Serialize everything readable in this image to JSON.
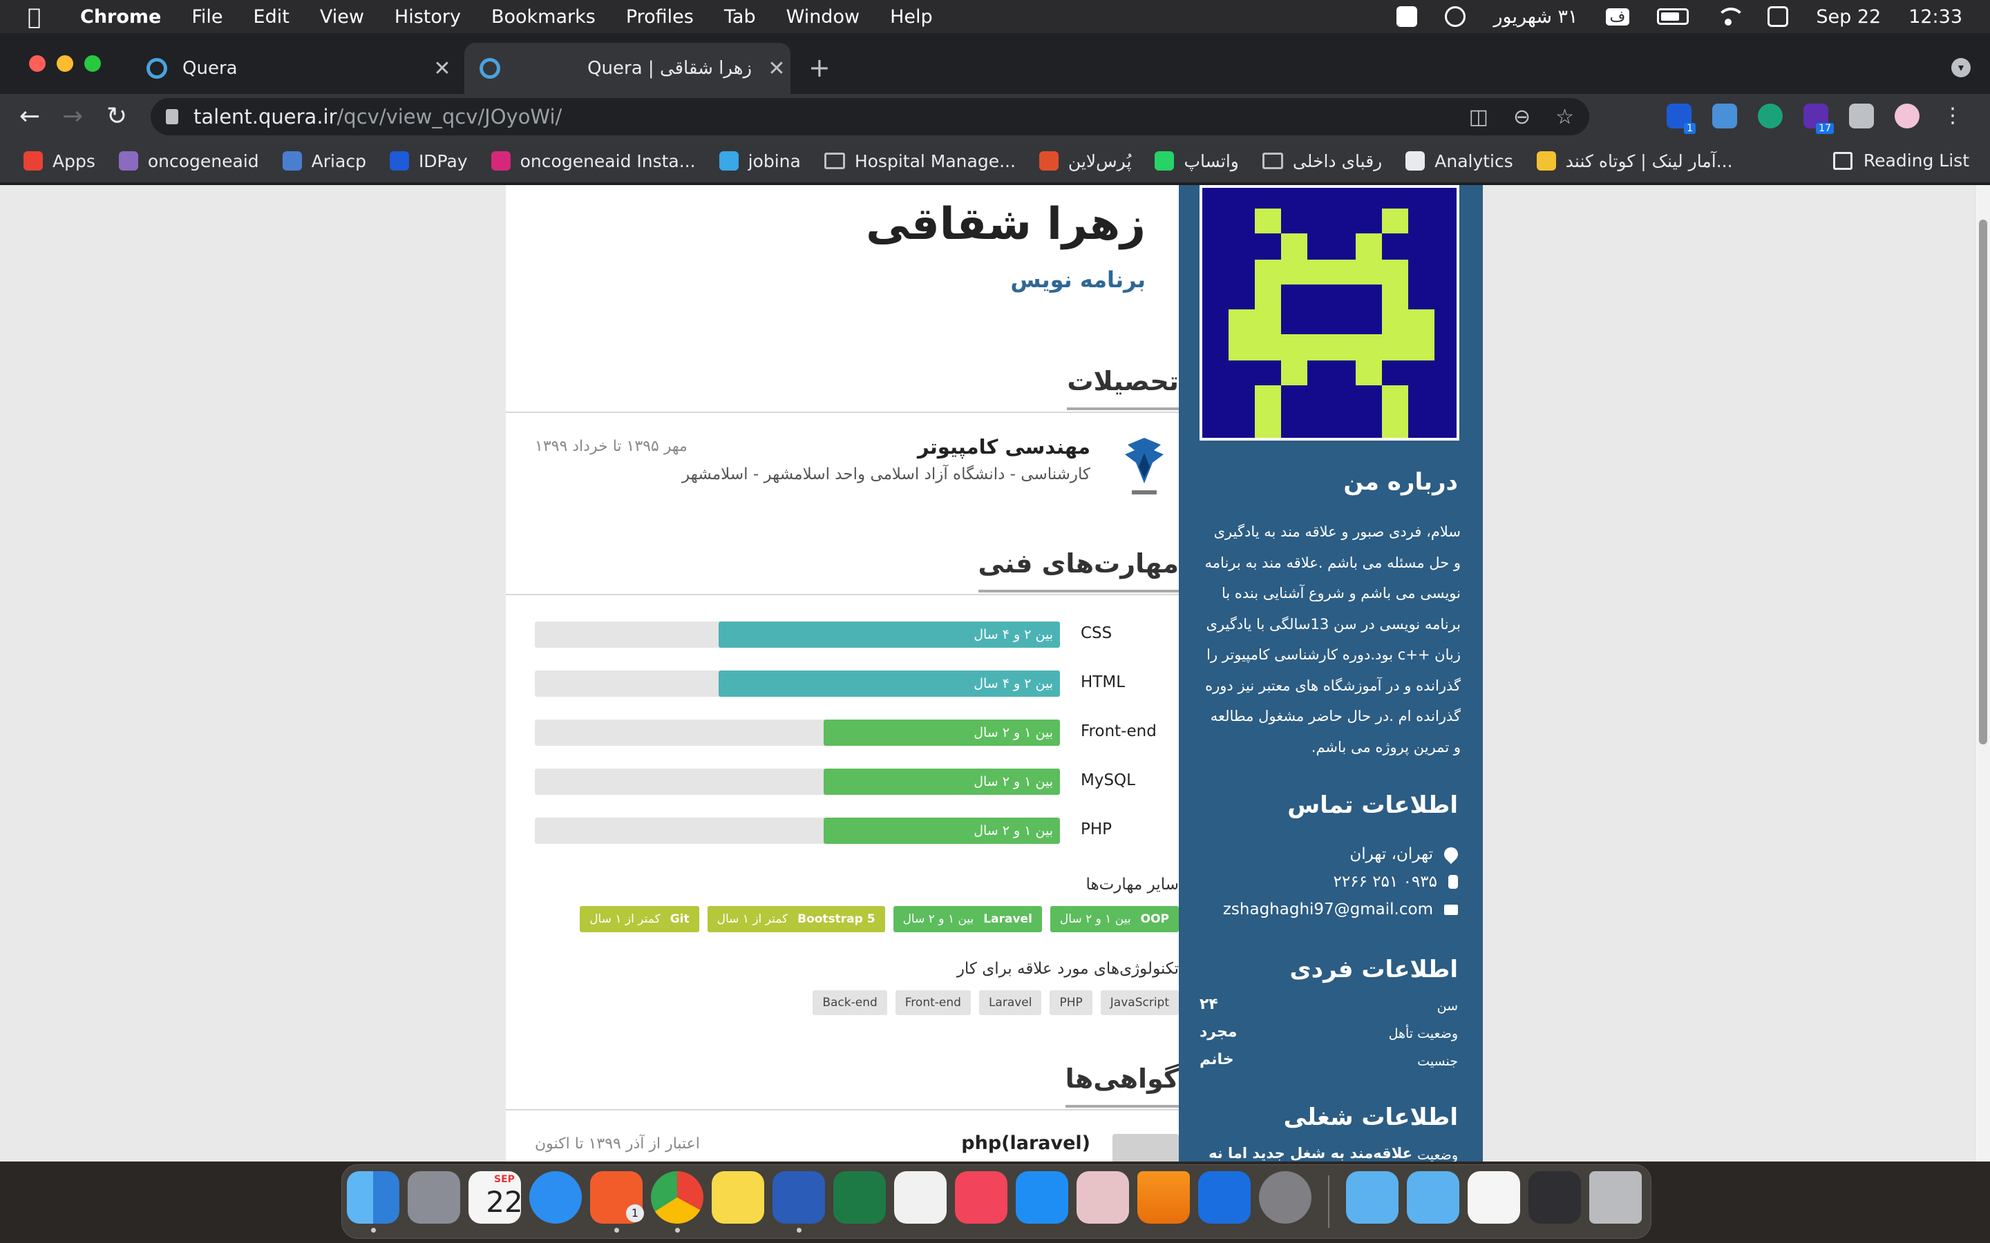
{
  "menubar": {
    "app": "Chrome",
    "items": [
      "File",
      "Edit",
      "View",
      "History",
      "Bookmarks",
      "Profiles",
      "Tab",
      "Window",
      "Help"
    ],
    "persian_date": "۳۱ شهریور",
    "keyboard": "ف",
    "date": "Sep 22",
    "time": "12:33"
  },
  "tabs": [
    {
      "title": "Quera",
      "active": false
    },
    {
      "title": "Quera | زهرا شقاقی",
      "active": true
    }
  ],
  "address": {
    "host": "talent.quera.ir",
    "path": "/qcv/view_qcv/JOyoWi/"
  },
  "bookmarks": [
    {
      "label": "Apps",
      "color": "#e94235"
    },
    {
      "label": "oncogeneaid",
      "color": "#8a6bbf"
    },
    {
      "label": "Ariacp",
      "color": "#4a7fd0"
    },
    {
      "label": "IDPay",
      "color": "#1e5bd8"
    },
    {
      "label": "oncogeneaid Insta...",
      "color": "#d6287a"
    },
    {
      "label": "jobina",
      "color": "#3aa7e8"
    },
    {
      "label": "Hospital Manage...",
      "color": "folder"
    },
    {
      "label": "پُرس‌لاین",
      "color": "#e04f2b"
    },
    {
      "label": "واتساپ",
      "color": "#25d366"
    },
    {
      "label": "رقبای داخلی",
      "color": "folder"
    },
    {
      "label": "Analytics",
      "color": "#e8eaed"
    },
    {
      "label": "آمار لینک | کوتاه کنند...",
      "color": "#f2c232"
    }
  ],
  "reading_list": "Reading List",
  "profile": {
    "name": "زهرا شقاقی",
    "title": "برنامه نویس"
  },
  "education": {
    "section_title": "تحصیلات",
    "degree_field": "مهندسی کامپیوتر",
    "dates": "مهر ۱۳۹۵ تا خرداد ۱۳۹۹",
    "school": "کارشناسی - دانشگاه آزاد اسلامی واحد اسلامشهر - اسلامشهر"
  },
  "skills": {
    "section_title": "مهارت‌های فنی",
    "items": [
      {
        "name": "CSS",
        "level_text": "بین ۲ و ۴ سال",
        "level": 0.65,
        "color": "#4cb3b5"
      },
      {
        "name": "HTML",
        "level_text": "بین ۲ و ۴ سال",
        "level": 0.65,
        "color": "#4cb3b5"
      },
      {
        "name": "Front-end",
        "level_text": "بین ۱ و ۲ سال",
        "level": 0.45,
        "color": "#5cbd5c"
      },
      {
        "name": "MySQL",
        "level_text": "بین ۱ و ۲ سال",
        "level": 0.45,
        "color": "#5cbd5c"
      },
      {
        "name": "PHP",
        "level_text": "بین ۱ و ۲ سال",
        "level": 0.45,
        "color": "#5cbd5c"
      }
    ],
    "other_label": "سایر مهارت‌ها",
    "other": [
      {
        "name": "OOP",
        "level_text": "بین ۱ و ۲ سال",
        "color": "#5cbd5c"
      },
      {
        "name": "Laravel",
        "level_text": "بین ۱ و ۲ سال",
        "color": "#5cbd5c"
      },
      {
        "name": "Bootstrap 5",
        "level_text": "کمتر از ۱ سال",
        "color": "#b5c73a"
      },
      {
        "name": "Git",
        "level_text": "کمتر از ۱ سال",
        "color": "#b5c73a"
      }
    ],
    "interests_label": "تکنولوژی‌های مورد علاقه برای کار",
    "interests": [
      "JavaScript",
      "PHP",
      "Laravel",
      "Front-end",
      "Back-end"
    ]
  },
  "certificates": {
    "section_title": "گواهی‌ها",
    "name": "php(laravel)",
    "dates": "اعتبار از آذر ۱۳۹۹ تا اکنون"
  },
  "sidebar": {
    "about_title": "درباره من",
    "about_text": "سلام، فردی صبور و علاقه مند به یادگیری و حل مسئله می باشم .علاقه مند به برنامه نویسی می باشم و شروع آشنایی بنده با برنامه نویسی در سن 13سالگی با یادگیری زبان ++c بود.دوره کارشناسی کامپیوتر را گذرانده و در آموزشگاه های معتبر نیز دوره گذرانده ام .در حال حاضر مشغول مطالعه و تمرین پروژه می باشم.",
    "contact_title": "اطلاعات تماس",
    "location": "تهران، تهران",
    "phone": "۰۹۳۵ ۲۵۱ ۲۲۶۶",
    "email": "zshaghaghi97@gmail.com",
    "personal_title": "اطلاعات فردی",
    "personal": [
      {
        "key": "سن",
        "value": "۲۴"
      },
      {
        "key": "وضعیت تأهل",
        "value": "مجرد"
      },
      {
        "key": "جنسیت",
        "value": "خانم"
      }
    ],
    "job_title": "اطلاعات شغلی",
    "job_status_key": "وضعیت",
    "job_status_value": "علاقه‌مند به شغل جدید اما نه"
  },
  "dock": {
    "calendar_month": "SEP",
    "calendar_day": "22",
    "badges": {
      "brave": "1"
    }
  },
  "extensions": {
    "badge1": "1",
    "badge2": "17"
  }
}
